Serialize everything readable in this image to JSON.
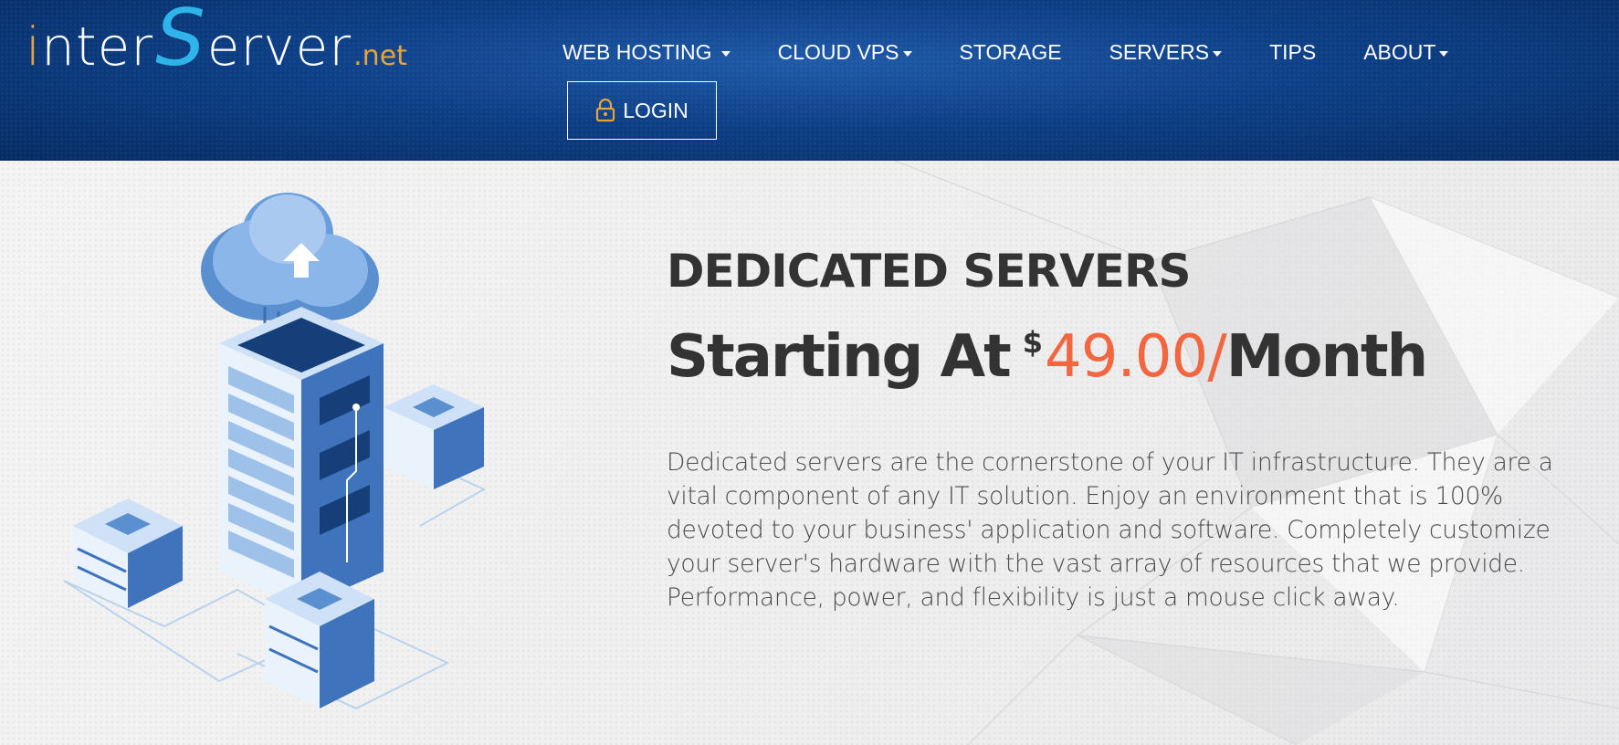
{
  "brand": {
    "logo_inter_i": "i",
    "logo_inter_rest": "nter",
    "logo_s": "S",
    "logo_erver": "erver",
    "logo_tld": ".net"
  },
  "nav": {
    "items": [
      {
        "label": "WEB HOSTING",
        "has_dropdown": true
      },
      {
        "label": "CLOUD VPS",
        "has_dropdown": true
      },
      {
        "label": "STORAGE",
        "has_dropdown": false
      },
      {
        "label": "SERVERS",
        "has_dropdown": true
      },
      {
        "label": "TIPS",
        "has_dropdown": false
      },
      {
        "label": "ABOUT",
        "has_dropdown": true
      }
    ],
    "login_label": "LOGIN",
    "login_icon": "padlock-icon"
  },
  "hero": {
    "title": "DEDICATED SERVERS",
    "price_prefix": "Starting At",
    "currency": "$",
    "amount": "49.00/",
    "period": "Month",
    "description": "Dedicated servers are the cornerstone of your IT infrastructure. They are a vital component of any IT solution. Enjoy an environment that is 100% devoted to your business' application and software. Completely customize your server's hardware with the vast array of resources that we provide. Performance, power, and flexibility is just a mouse click away.",
    "illustration": "cloud-server-rack-illustration"
  },
  "colors": {
    "header_blue": "#0d3f86",
    "accent_orange": "#f26640",
    "logo_orange": "#e8a33a",
    "logo_cyan": "#2fb4ea",
    "text_dark": "#333333"
  }
}
